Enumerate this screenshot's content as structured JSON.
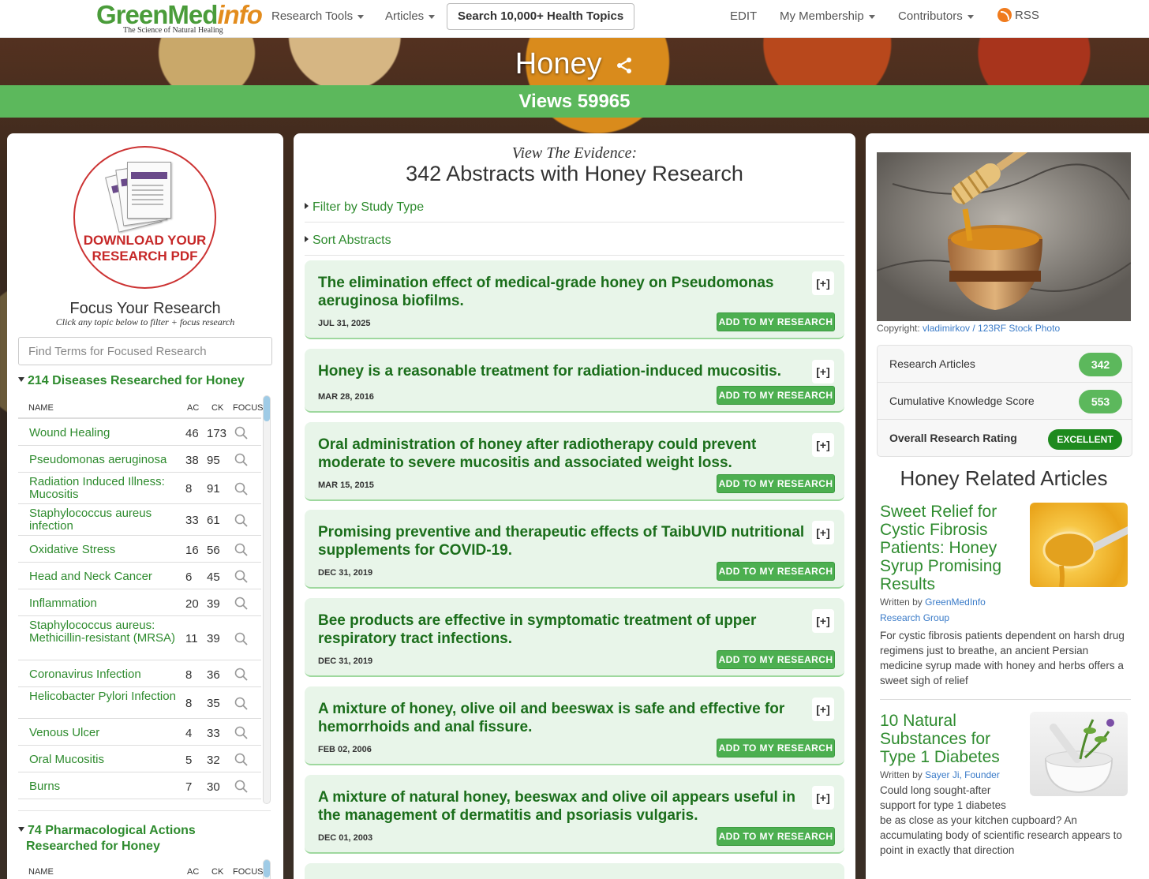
{
  "nav": {
    "logo_green": "GreenMed",
    "logo_orange": "info",
    "logo_tagline": "The Science of Natural Healing",
    "research_tools": "Research Tools",
    "articles": "Articles",
    "search": "Search 10,000+ Health Topics",
    "edit": "EDIT",
    "membership": "My Membership",
    "contributors": "Contributors",
    "rss": "RSS"
  },
  "hero": {
    "title": "Honey",
    "views": "Views 59965"
  },
  "left": {
    "pdf_line1": "DOWNLOAD YOUR",
    "pdf_line2": "RESEARCH PDF",
    "focus_title": "Focus Your Research",
    "focus_sub": "Click any topic below to filter + focus research",
    "find_placeholder": "Find Terms for Focused Research",
    "diseases_head": "214 Diseases Researched for Honey",
    "pharm_head_1": "74 Pharmacological Actions",
    "pharm_head_2": "Researched for Honey",
    "col_name": "NAME",
    "col_ac": "AC",
    "col_ck": "CK",
    "col_focus": "FOCUS",
    "rows": [
      {
        "name": "Wound Healing",
        "ac": "46",
        "ck": "173"
      },
      {
        "name": "Pseudomonas aeruginosa",
        "ac": "38",
        "ck": "95"
      },
      {
        "name": "Radiation Induced Illness: Mucositis",
        "ac": "8",
        "ck": "91"
      },
      {
        "name": "Staphylococcus aureus infection",
        "ac": "33",
        "ck": "61"
      },
      {
        "name": "Oxidative Stress",
        "ac": "16",
        "ck": "56"
      },
      {
        "name": "Head and Neck Cancer",
        "ac": "6",
        "ck": "45"
      },
      {
        "name": "Inflammation",
        "ac": "20",
        "ck": "39"
      },
      {
        "name": "Staphylococcus aureus: Methicillin-resistant (MRSA)",
        "ac": "11",
        "ck": "39"
      },
      {
        "name": "Coronavirus Infection",
        "ac": "8",
        "ck": "36"
      },
      {
        "name": "Helicobacter Pylori Infection",
        "ac": "8",
        "ck": "35"
      },
      {
        "name": "Venous Ulcer",
        "ac": "4",
        "ck": "33"
      },
      {
        "name": "Oral Mucositis",
        "ac": "5",
        "ck": "32"
      },
      {
        "name": "Burns",
        "ac": "7",
        "ck": "30"
      }
    ]
  },
  "center": {
    "view_evidence": "View The Evidence:",
    "count_title": "342 Abstracts with Honey Research",
    "filter": "Filter by Study Type",
    "sort": "Sort Abstracts",
    "plus": "[+]",
    "add": "ADD TO MY RESEARCH",
    "abstracts": [
      {
        "title": "The elimination effect of medical-grade honey on Pseudomonas aeruginosa biofilms.",
        "date": "JUL 31, 2025"
      },
      {
        "title": "Honey is a reasonable treatment for radiation-induced mucositis.",
        "date": "MAR 28, 2016"
      },
      {
        "title": "Oral administration of honey after radiotherapy could prevent moderate to severe mucositis and associated weight loss.",
        "date": "MAR 15, 2015"
      },
      {
        "title": "Promising preventive and therapeutic effects of TaibUVID nutritional supplements for COVID-19.",
        "date": "DEC 31, 2019"
      },
      {
        "title": "Bee products are effective in symptomatic treatment of upper respiratory tract infections.",
        "date": "DEC 31, 2019"
      },
      {
        "title": "A mixture of honey, olive oil and beeswax is safe and effective for hemorrhoids and anal fissure.",
        "date": "FEB 02, 2006"
      },
      {
        "title": "A mixture of natural honey, beeswax and olive oil appears useful in the management of dermatitis and psoriasis vulgaris.",
        "date": "DEC 01, 2003"
      }
    ]
  },
  "right": {
    "copyright_label": "Copyright:",
    "copyright_link": "vladimirkov / 123RF Stock Photo",
    "stat1_label": "Research Articles",
    "stat1_value": "342",
    "stat2_label": "Cumulative Knowledge Score",
    "stat2_value": "553",
    "stat3_label": "Overall Research Rating",
    "stat3_value": "EXCELLENT",
    "related_title": "Honey Related Articles",
    "art1_title": "Sweet Relief for Cystic Fibrosis Patients: Honey Syrup Promising Results",
    "art1_by": "Written by",
    "art1_author_1": "GreenMedInfo",
    "art1_author_2": "Research Group",
    "art1_excerpt_1": "For cystic fibrosis patients dependent on harsh drug",
    "art1_excerpt_2": "regimens just to breathe, an ancient Persian",
    "art1_excerpt_3": "medicine syrup made with honey and herbs offers a",
    "art1_excerpt_4": "sweet sigh of relief",
    "art2_title": "10 Natural Substances for Type 1 Diabetes",
    "art2_by": "Written by",
    "art2_author": "Sayer Ji, Founder",
    "art2_excerpt_1": "Could long sought-after",
    "art2_excerpt_2": "support for type 1 diabetes",
    "art2_excerpt_3": "be as close as your kitchen cupboard? An",
    "art2_excerpt_4": "accumulating body of scientific research appears to",
    "art2_excerpt_5": "point in exactly that direction"
  }
}
